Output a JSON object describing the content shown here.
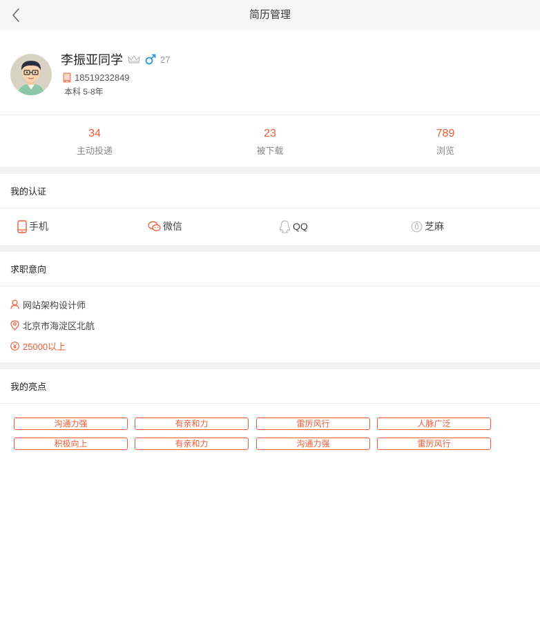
{
  "header": {
    "title": "简历管理",
    "back_icon": "chevron-left-icon"
  },
  "profile": {
    "name": "李振亚同学",
    "age": "27",
    "phone": "18519232849",
    "education": "本科 5-8年",
    "gender": "male"
  },
  "stats": [
    {
      "value": "34",
      "label": "主动投递"
    },
    {
      "value": "23",
      "label": "被下载"
    },
    {
      "value": "789",
      "label": "浏览"
    }
  ],
  "auth": {
    "title": "我的认证",
    "items": [
      {
        "label": "手机",
        "icon": "phone-icon"
      },
      {
        "label": "微信",
        "icon": "wechat-icon"
      },
      {
        "label": "QQ",
        "icon": "qq-icon"
      },
      {
        "label": "芝麻",
        "icon": "sesame-icon"
      }
    ]
  },
  "intent": {
    "title": "求职意向",
    "position": "网站架构设计师",
    "location": "北京市海淀区北航",
    "salary": "25000以上"
  },
  "highlights": {
    "title": "我的亮点",
    "tags": [
      "沟通力强",
      "有亲和力",
      "雷厉风行",
      "人脉广泛",
      "积极向上",
      "有亲和力",
      "沟通力强",
      "雷厉风行"
    ]
  },
  "colors": {
    "accent": "#ee5a33",
    "blue": "#2a9ad6",
    "header_bg": "#f6f6f6",
    "divider": "#f2f2f2"
  }
}
